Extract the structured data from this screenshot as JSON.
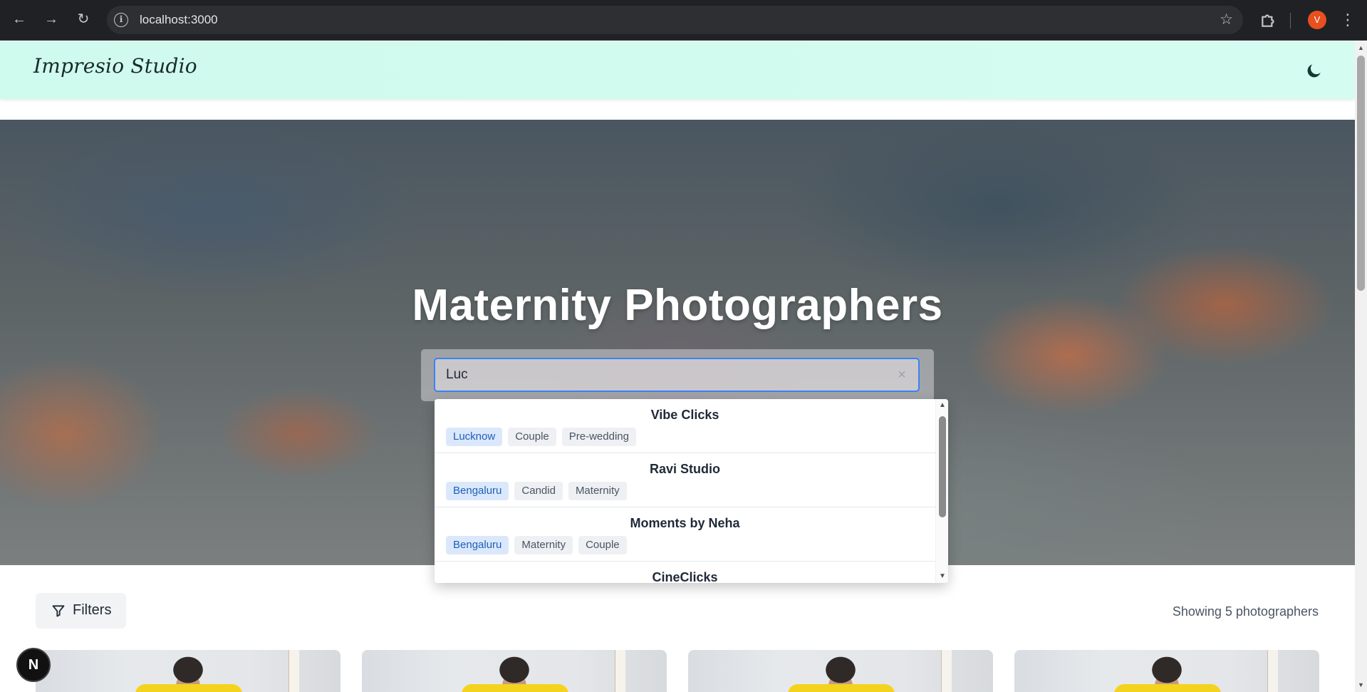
{
  "browser": {
    "url": "localhost:3000",
    "profile_initial": "V",
    "icons": [
      "back-arrow-icon",
      "forward-arrow-icon",
      "reload-icon",
      "site-info-icon",
      "bookmark-star-icon",
      "extensions-icon",
      "kebab-menu-icon"
    ]
  },
  "header": {
    "logo": "Impresio Studio",
    "theme_icon": "moon-icon",
    "bg_color": "#cffaee"
  },
  "hero": {
    "title": "Maternity Photographers",
    "search": {
      "value": "Luc",
      "clear_icon": "close-icon",
      "border_color": "#3b82f6"
    }
  },
  "suggestions": [
    {
      "name": "Vibe Clicks",
      "city": "Lucknow",
      "tags": [
        "Couple",
        "Pre-wedding"
      ]
    },
    {
      "name": "Ravi Studio",
      "city": "Bengaluru",
      "tags": [
        "Candid",
        "Maternity"
      ]
    },
    {
      "name": "Moments by Neha",
      "city": "Bengaluru",
      "tags": [
        "Maternity",
        "Couple"
      ]
    },
    {
      "name": "CineClicks",
      "city": "",
      "tags": []
    }
  ],
  "toolbar": {
    "filters_label": "Filters",
    "filter_icon": "funnel-icon",
    "count_text": "Showing 5 photographers"
  },
  "dev_badge": "N",
  "colors": {
    "city_tag_bg": "#dbe8fb",
    "city_tag_text": "#1d5fb8",
    "tag_bg": "#eef0f3"
  }
}
